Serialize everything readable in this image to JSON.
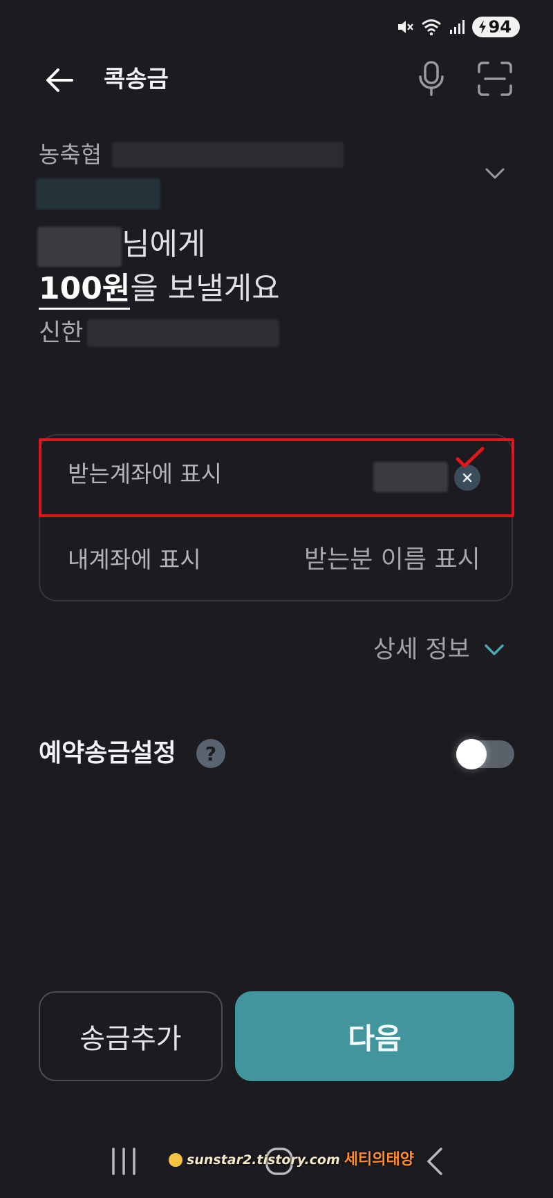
{
  "status": {
    "battery": "94"
  },
  "header": {
    "title": "콕송금"
  },
  "account": {
    "bank_label": "농축협"
  },
  "transfer": {
    "recipient_suffix": "님에게",
    "amount": "100원",
    "amount_suffix": "을 보낼게요",
    "recipient_bank": "신한"
  },
  "memo": {
    "receiver_display_label": "받는계좌에 표시",
    "my_display_label": "내계좌에 표시",
    "my_display_placeholder": "받는분 이름 표시"
  },
  "detail": {
    "label": "상세 정보"
  },
  "schedule": {
    "label": "예약송금설정",
    "help": "?",
    "enabled": false
  },
  "buttons": {
    "add_label": "송금추가",
    "next_label": "다음"
  },
  "watermark": {
    "url": "sunstar2.tistory.com",
    "name": "세티의태양"
  },
  "colors": {
    "background": "#1b1b20",
    "accent": "#41959c",
    "highlight": "#e0151d"
  }
}
